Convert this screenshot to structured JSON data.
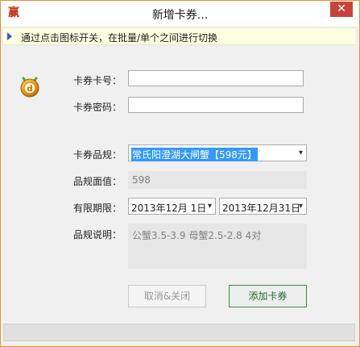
{
  "window": {
    "title": "新增卡券...",
    "app_icon_char": "赢",
    "close_label": "✕"
  },
  "hint": {
    "text": "通过点击图标开关，在批量/单个之间进行切换"
  },
  "form": {
    "card_number_label": "卡券卡号：",
    "card_number_value": "",
    "card_password_label": "卡券密码：",
    "card_password_value": "",
    "product_label": "卡券品规：",
    "product_value": "常氏阳澄湖大闸蟹【598元】",
    "face_value_label": "品规面值：",
    "face_value": "598",
    "validity_label": "有限期限：",
    "validity_start": "2013年12月 1日",
    "validity_end": "2013年12月31日",
    "description_label": "品规说明：",
    "description_value": "公蟹3.5-3.9  母蟹2.5-2.8  4对"
  },
  "buttons": {
    "cancel_label": "取消&关闭",
    "add_label": "添加卡券"
  },
  "colors": {
    "accent_orange": "#e8913a",
    "close_red": "#c7443a",
    "selection_blue": "#3399ff",
    "hint_bg": "#ffffe1",
    "add_button_border": "#3a8d45"
  },
  "icons": {
    "hint_arrow": "blue-triangle-right",
    "toggle_icon": "gold-coin-icon",
    "dropdown": "chevron-down-icon"
  }
}
